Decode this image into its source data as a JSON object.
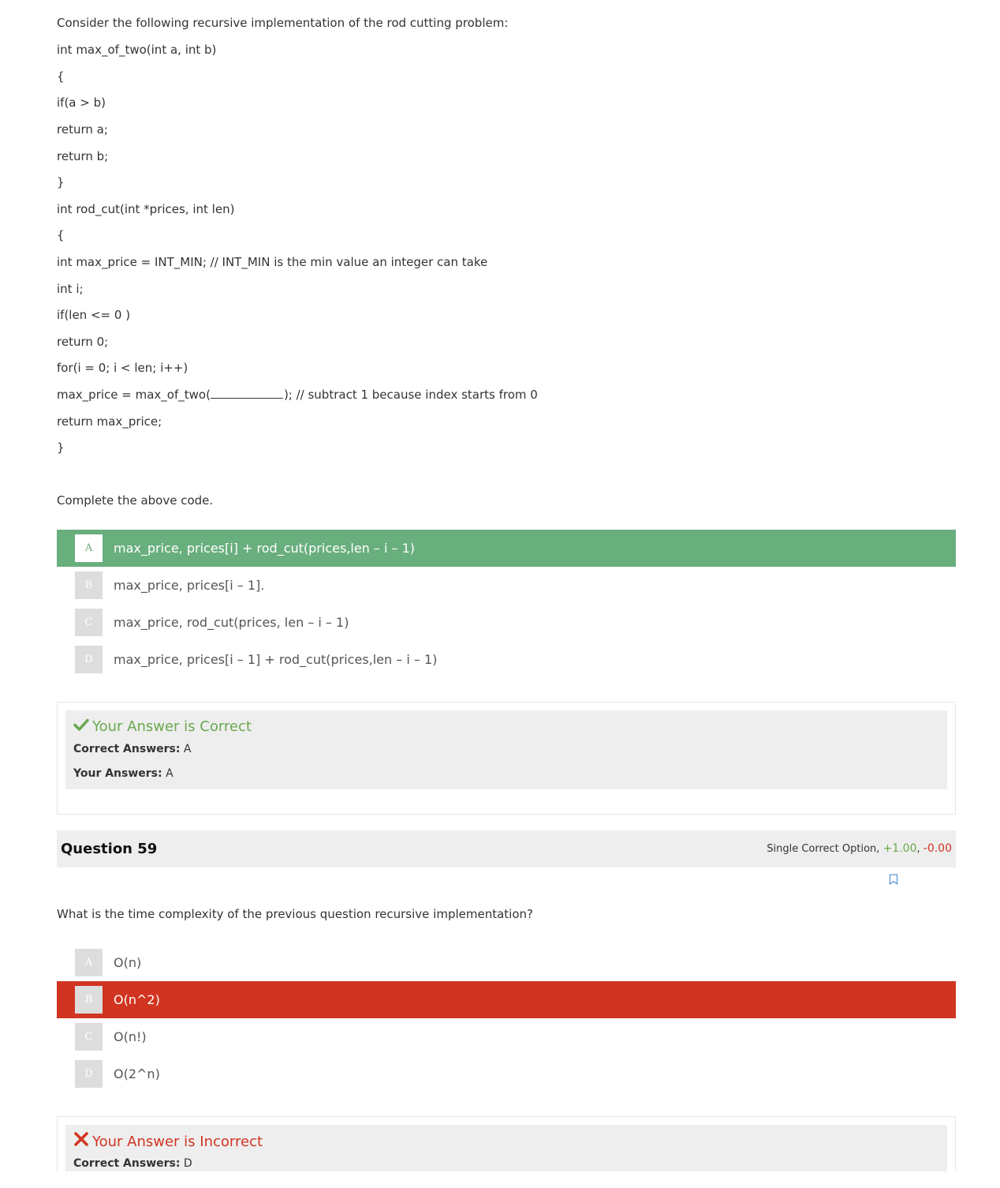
{
  "q58": {
    "intro": "Consider the following recursive implementation of the rod cutting problem:",
    "code": [
      "int max_of_two(int a, int b)",
      "{",
      "if(a > b)",
      "return a;",
      "return b;",
      "}",
      "int rod_cut(int *prices, int len)",
      "{",
      "int max_price = INT_MIN; // INT_MIN is the min value an integer can take",
      "int i;",
      "if(len <= 0 )",
      "return 0;",
      "for(i = 0; i < len; i++)"
    ],
    "blank_line_before": "max_price = max_of_two(",
    "blank_line_after": "); // subtract 1 because index starts from 0",
    "code_tail": [
      "return max_price;",
      "}"
    ],
    "prompt": "Complete the above code.",
    "options": [
      {
        "letter": "A",
        "text": "max_price, prices[i] + rod_cut(prices,len – i – 1)"
      },
      {
        "letter": "B",
        "text": "max_price, prices[i – 1]."
      },
      {
        "letter": "C",
        "text": "max_price, rod_cut(prices, len – i – 1)"
      },
      {
        "letter": "D",
        "text": "max_price, prices[i – 1] + rod_cut(prices,len – i – 1)"
      }
    ],
    "result": {
      "icon": "check-icon",
      "title": "Your Answer is Correct",
      "correct_label": "Correct Answers:",
      "correct_value": "A",
      "your_label": "Your Answers:",
      "your_value": "A"
    }
  },
  "q59": {
    "title": "Question 59",
    "meta_type": "Single Correct Option,",
    "meta_pos": "+1.00",
    "meta_sep": ",",
    "meta_neg": "-0.00",
    "prompt": "What is the time complexity of the previous question recursive implementation?",
    "options": [
      {
        "letter": "A",
        "text": "O(n)"
      },
      {
        "letter": "B",
        "text": "O(n^2)"
      },
      {
        "letter": "C",
        "text": "O(n!)"
      },
      {
        "letter": "D",
        "text": "O(2^n)"
      }
    ],
    "result": {
      "icon": "cross-icon",
      "title": "Your Answer is Incorrect",
      "correct_label": "Correct Answers:",
      "correct_value": "D"
    }
  },
  "colors": {
    "correct": "#69af7e",
    "wrong": "#d13420",
    "header_bg": "#eeeeee"
  }
}
